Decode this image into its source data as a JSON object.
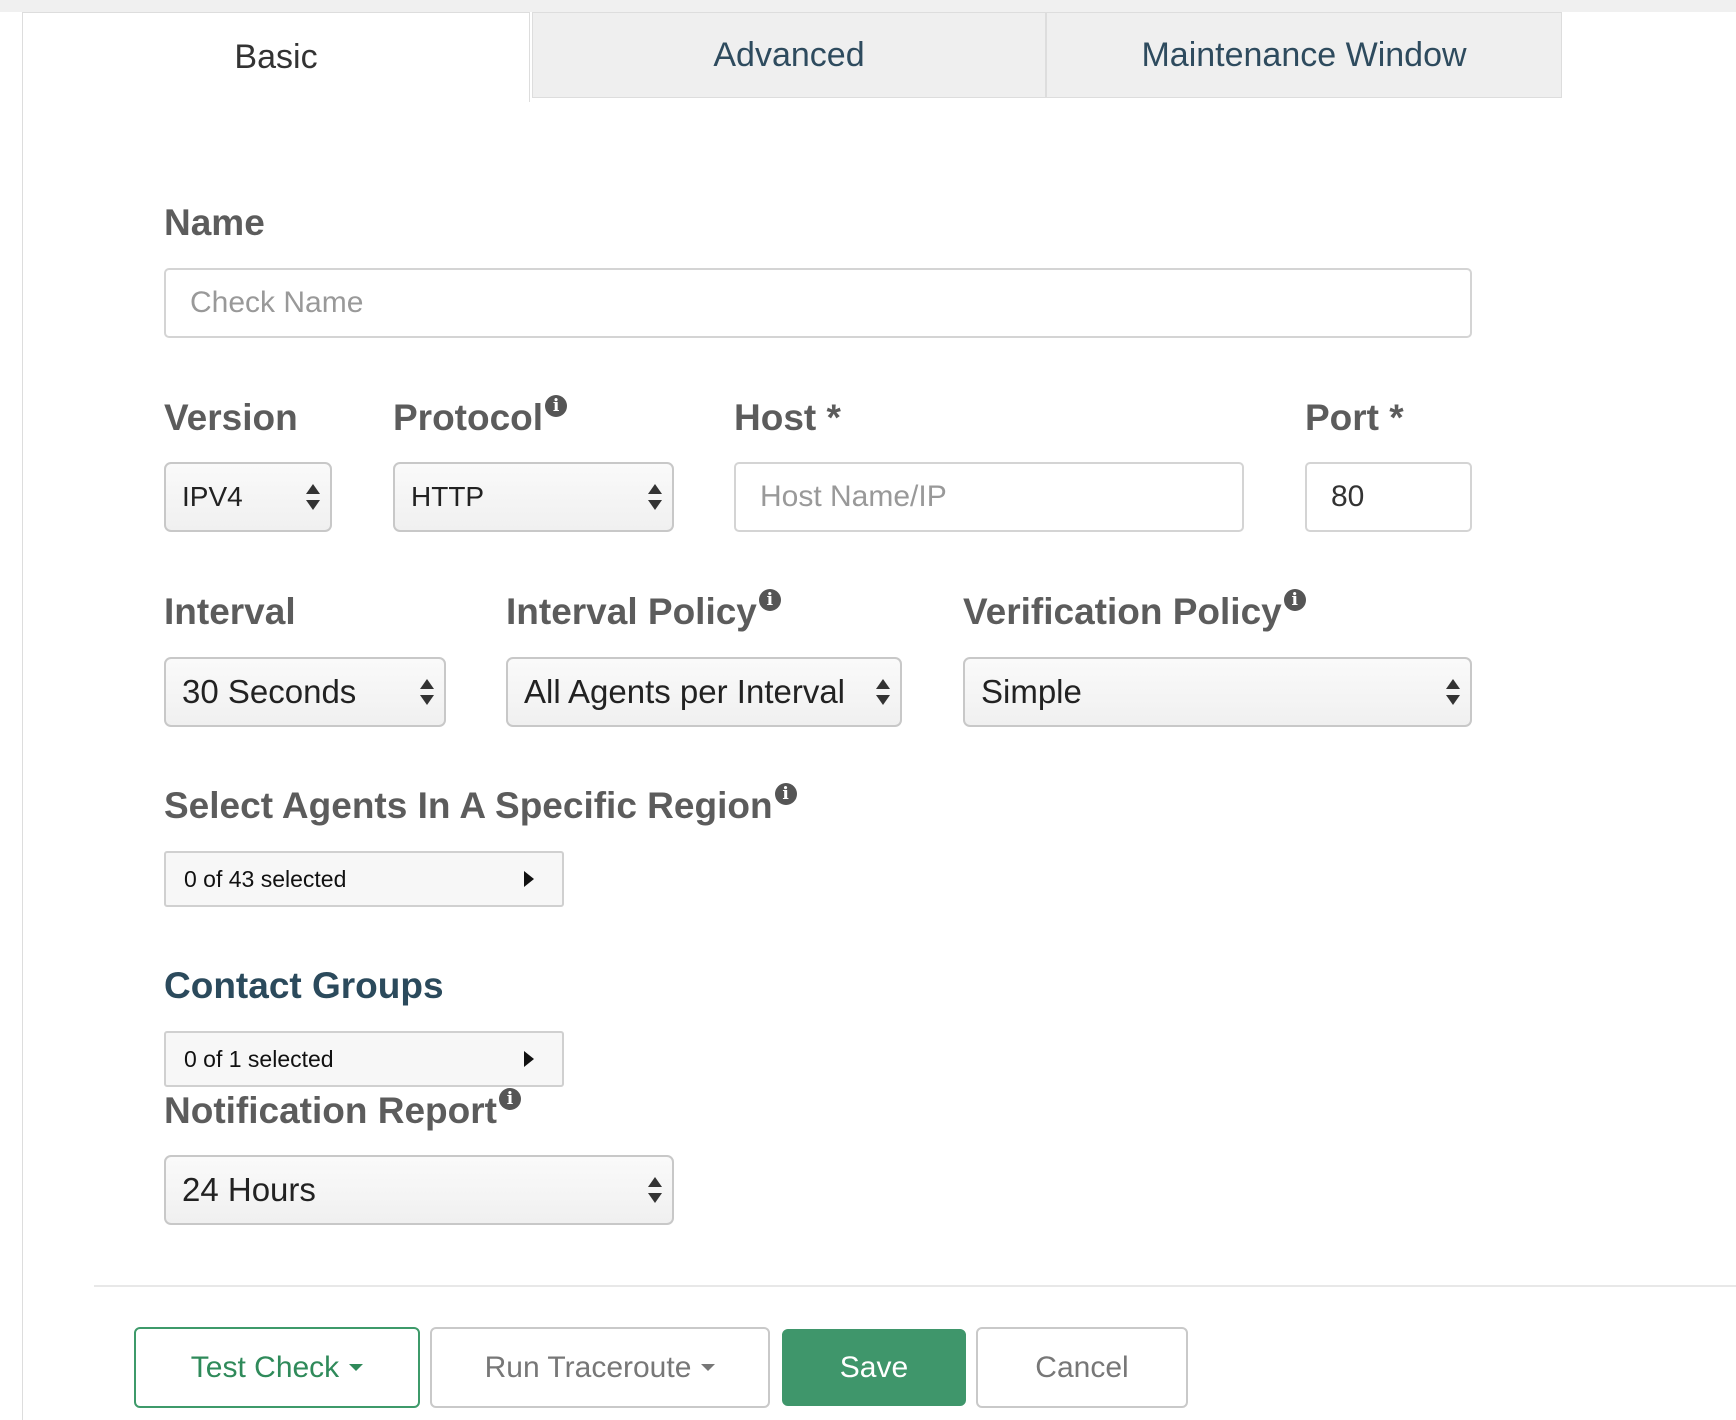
{
  "tabs": [
    {
      "label": "Basic",
      "active": true
    },
    {
      "label": "Advanced",
      "active": false
    },
    {
      "label": "Maintenance Window",
      "active": false
    }
  ],
  "form": {
    "name_label": "Name",
    "name_placeholder": "Check Name",
    "version_label": "Version",
    "version_value": "IPV4",
    "protocol_label": "Protocol",
    "protocol_value": "HTTP",
    "host_label": "Host *",
    "host_placeholder": "Host Name/IP",
    "port_label": "Port *",
    "port_value": "80",
    "interval_label": "Interval",
    "interval_value": "30 Seconds",
    "interval_policy_label": "Interval Policy",
    "interval_policy_value": "All Agents per Interval",
    "verification_policy_label": "Verification Policy",
    "verification_policy_value": "Simple",
    "region_label": "Select Agents In A Specific Region",
    "region_value": "0 of 43 selected",
    "contact_groups_label": "Contact Groups",
    "contact_groups_value": "0 of 1 selected",
    "notification_report_label": "Notification Report",
    "notification_report_value": "24 Hours"
  },
  "info_glyph": "i",
  "buttons": {
    "test_check": "Test Check",
    "run_traceroute": "Run Traceroute",
    "save": "Save",
    "cancel": "Cancel"
  },
  "colors": {
    "primary_green": "#3f966b",
    "heading_dark": "#2b4a5c"
  }
}
